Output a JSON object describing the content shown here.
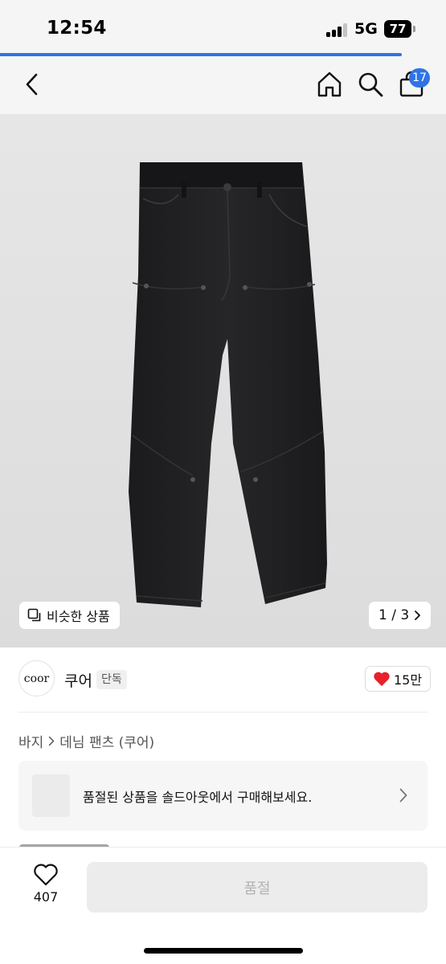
{
  "status_bar": {
    "time": "12:54",
    "network": "5G",
    "battery": "77"
  },
  "page_load": {
    "progress_percent": 90
  },
  "nav": {
    "icons": [
      "back-chevron-icon",
      "home-icon",
      "search-icon",
      "shopping-bag-icon"
    ],
    "cart_count": "17"
  },
  "gallery": {
    "image": "black-denim-pants",
    "similar_label": "비슷한 상품",
    "page_indicator": "1 / 3"
  },
  "shop": {
    "logo_text": "coor",
    "name": "쿠어",
    "badge": "단독",
    "like_count": "15만"
  },
  "breadcrumb": {
    "items": [
      "바지",
      "데님 팬츠 (쿠어)"
    ]
  },
  "soldout_banner": {
    "text": "품절된 상품을 솔드아웃에서 구매해보세요."
  },
  "bottom_bar": {
    "wishlist_count": "407",
    "purchase_label": "품절"
  },
  "colors": {
    "accent": "#2f74e6",
    "heart": "#e8202a",
    "disabled_button": "#ececec"
  }
}
